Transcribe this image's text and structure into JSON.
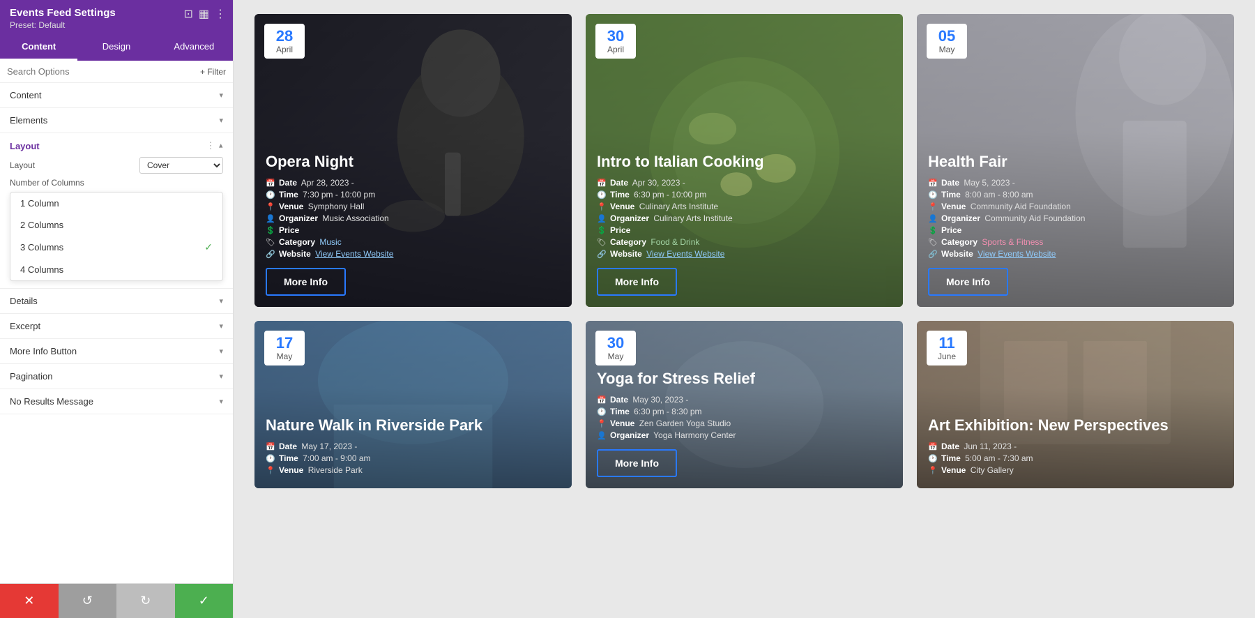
{
  "sidebar": {
    "title": "Events Feed Settings",
    "preset": "Preset: Default",
    "header_icons": [
      "resize-icon",
      "layout-icon",
      "more-icon"
    ],
    "tabs": [
      {
        "label": "Content",
        "active": true
      },
      {
        "label": "Design",
        "active": false
      },
      {
        "label": "Advanced",
        "active": false
      }
    ],
    "search_placeholder": "Search Options",
    "filter_label": "+ Filter",
    "sections": [
      {
        "label": "Content",
        "open": false
      },
      {
        "label": "Elements",
        "open": false
      },
      {
        "label": "Layout",
        "open": true
      },
      {
        "label": "Details",
        "open": false
      },
      {
        "label": "Excerpt",
        "open": false
      },
      {
        "label": "More Info Button",
        "open": false
      },
      {
        "label": "Pagination",
        "open": false
      },
      {
        "label": "No Results Message",
        "open": false
      }
    ],
    "layout": {
      "layout_label": "Layout",
      "layout_value": "Cover",
      "columns_label": "Number of Columns",
      "columns_options": [
        {
          "label": "1 Column",
          "value": 1,
          "selected": false
        },
        {
          "label": "2 Columns",
          "value": 2,
          "selected": false
        },
        {
          "label": "3 Columns",
          "value": 3,
          "selected": true
        },
        {
          "label": "4 Columns",
          "value": 4,
          "selected": false
        }
      ]
    },
    "bottom_buttons": [
      {
        "label": "✕",
        "type": "red",
        "name": "cancel-button"
      },
      {
        "label": "↺",
        "type": "gray",
        "name": "reset-button"
      },
      {
        "label": "↻",
        "type": "light-gray",
        "name": "redo-button"
      },
      {
        "label": "✓",
        "type": "green",
        "name": "save-button"
      }
    ]
  },
  "events": [
    {
      "id": 1,
      "day": "28",
      "month": "April",
      "title": "Opera Night",
      "date": "Apr 28, 2023 -",
      "time": "7:30 pm - 10:00 pm",
      "venue": "Symphony Hall",
      "organizer": "Music Association",
      "price": "",
      "category": "Music",
      "website_label": "View Events Website",
      "more_info": "More Info",
      "bg_class": "card-bg-dark"
    },
    {
      "id": 2,
      "day": "30",
      "month": "April",
      "title": "Intro to Italian Cooking",
      "date": "Apr 30, 2023 -",
      "time": "6:30 pm - 10:00 pm",
      "venue": "Culinary Arts Institute",
      "organizer": "Culinary Arts Institute",
      "price": "",
      "category": "Food & Drink",
      "website_label": "View Events Website",
      "more_info": "More Info",
      "bg_class": "card-bg-food"
    },
    {
      "id": 3,
      "day": "05",
      "month": "May",
      "title": "Health Fair",
      "date": "May 5, 2023 -",
      "time": "8:00 am - 8:00 am",
      "venue": "Community Aid Foundation",
      "organizer": "Community Aid Foundation",
      "price": "",
      "category": "Sports & Fitness",
      "website_label": "View Events Website",
      "more_info": "More Info",
      "bg_class": "card-bg-health"
    },
    {
      "id": 4,
      "day": "17",
      "month": "May",
      "title": "Nature Walk in Riverside Park",
      "date": "May 17, 2023 -",
      "time": "7:00 am - 9:00 am",
      "venue": "Riverside Park",
      "organizer": "",
      "price": "",
      "category": "",
      "website_label": "",
      "more_info": "",
      "bg_class": "card-bg-nature"
    },
    {
      "id": 5,
      "day": "30",
      "month": "May",
      "title": "Yoga for Stress Relief",
      "date": "May 30, 2023 -",
      "time": "6:30 pm - 8:30 pm",
      "venue": "Zen Garden Yoga Studio",
      "organizer": "Yoga Harmony Center",
      "price": "",
      "category": "",
      "website_label": "",
      "more_info": "More Info",
      "bg_class": "card-bg-yoga"
    },
    {
      "id": 6,
      "day": "11",
      "month": "June",
      "title": "Art Exhibition: New Perspectives",
      "date": "Jun 11, 2023 -",
      "time": "5:00 am - 7:30 am",
      "venue": "City Gallery",
      "organizer": "",
      "price": "",
      "category": "",
      "website_label": "",
      "more_info": "",
      "bg_class": "card-bg-art"
    }
  ]
}
